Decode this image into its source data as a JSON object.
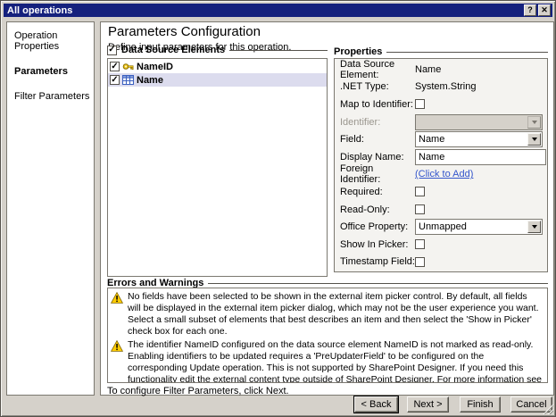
{
  "window": {
    "title": "All operations",
    "help_button_glyph": "?",
    "close_button_glyph": "✕"
  },
  "sidebar": {
    "active_item": "Parameters",
    "items": [
      {
        "label": "Operation Properties"
      },
      {
        "label": "Parameters"
      },
      {
        "label": "Filter Parameters"
      }
    ]
  },
  "main": {
    "title": "Parameters Configuration",
    "subtitle": "Define input parameters for this operation.",
    "data_source_elements": {
      "header": "Data Source Elements",
      "header_checked": true,
      "items": [
        {
          "label": "NameID",
          "checked": true,
          "icon": "key-icon",
          "selected": false
        },
        {
          "label": "Name",
          "checked": true,
          "icon": "table-icon",
          "selected": true
        }
      ]
    },
    "properties": {
      "header": "Properties",
      "rows": [
        {
          "label": "Data Source Element:",
          "value": "Name",
          "control": "static"
        },
        {
          "label": ".NET Type:",
          "value": "System.String",
          "control": "static"
        },
        {
          "label": "Map to Identifier:",
          "control": "checkbox",
          "checked": false
        },
        {
          "label": "Identifier:",
          "value": "",
          "control": "dropdown",
          "disabled": true
        },
        {
          "label": "Field:",
          "value": "Name",
          "control": "dropdown",
          "disabled": false
        },
        {
          "label": "Display Name:",
          "value": "Name",
          "control": "textbox"
        },
        {
          "label": "Foreign Identifier:",
          "value": "(Click to Add)",
          "control": "link"
        },
        {
          "label": "Required:",
          "control": "checkbox",
          "checked": false
        },
        {
          "label": "Read-Only:",
          "control": "checkbox",
          "checked": false
        },
        {
          "label": "Office Property:",
          "value": "Unmapped",
          "control": "dropdown",
          "disabled": false
        },
        {
          "label": "Show In Picker:",
          "control": "checkbox",
          "checked": false
        },
        {
          "label": "Timestamp Field:",
          "control": "checkbox",
          "checked": false
        }
      ]
    },
    "errors_and_warnings": {
      "header": "Errors and Warnings",
      "items": [
        {
          "icon": "warning-icon",
          "text": "No fields have been selected to be shown in the external item picker control. By default, all fields will be displayed in the external item picker dialog, which may not be the user experience you want. Select a small subset of elements that best describes an item and then select the 'Show in Picker' check box for each one."
        },
        {
          "icon": "warning-icon",
          "text": "The identifier NameID configured on the data source element NameID is not marked as read-only. Enabling identifiers to be updated requires a 'PreUpdaterField' to be configured on the corresponding Update operation. This is not supported by SharePoint Designer. If you need this functionality edit the external content type outside of SharePoint Designer. For more information see the documentation for 'PreUpdaterField' available at msdn.microsoft.com"
        }
      ]
    },
    "footer_note": "To configure Filter Parameters, click Next."
  },
  "buttons": {
    "back": "< Back",
    "next": "Next >",
    "finish": "Finish",
    "cancel": "Cancel"
  },
  "colors": {
    "title_bar": "#15217d",
    "dialog_chrome": "#d5d1ca",
    "selection_row": "#dcdcee",
    "link": "#3355cc",
    "warning_yellow": "#ffcc00"
  }
}
